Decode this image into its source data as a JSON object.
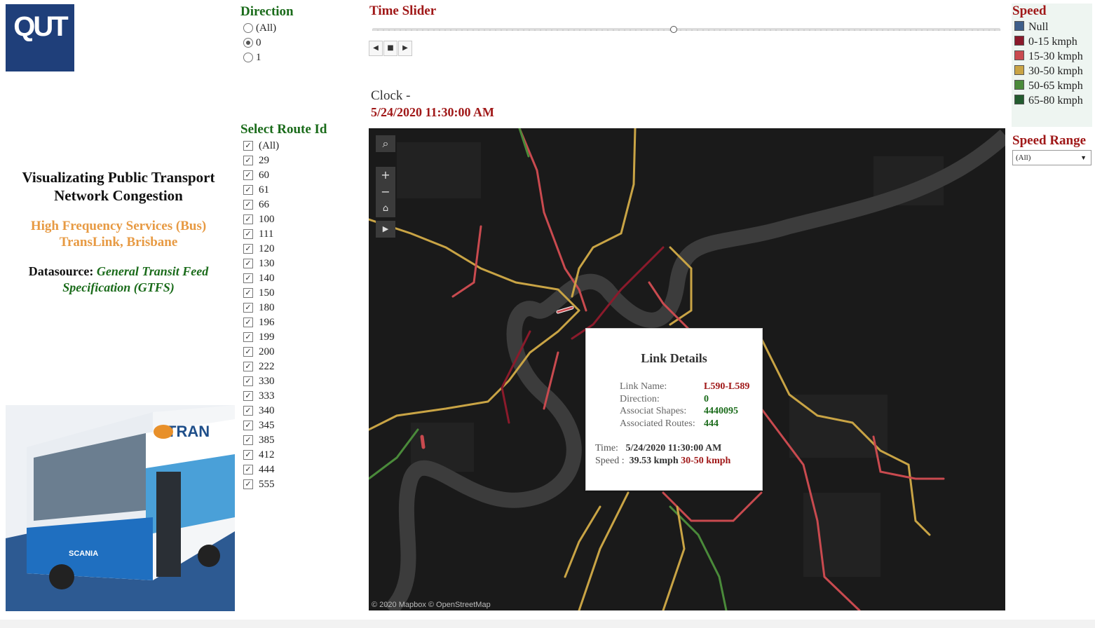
{
  "logo": {
    "text": "QUT"
  },
  "left_panel": {
    "title": "Visualizating Public Transport Network Congestion",
    "subtitle_line1": "High Frequency Services (Bus)",
    "subtitle_line2": "TransLink, Brisbane",
    "datasource_label": "Datasource:",
    "datasource_value": "General Transit Feed Specification (GTFS)"
  },
  "direction_filter": {
    "title": "Direction",
    "options": [
      "(All)",
      "0",
      "1"
    ],
    "selected": "0"
  },
  "route_filter": {
    "title": "Select Route Id",
    "options": [
      "(All)",
      "29",
      "60",
      "61",
      "66",
      "100",
      "111",
      "120",
      "130",
      "140",
      "150",
      "180",
      "196",
      "199",
      "200",
      "222",
      "330",
      "333",
      "340",
      "345",
      "385",
      "412",
      "444",
      "555"
    ],
    "all_checked": true
  },
  "time_slider": {
    "title": "Time Slider",
    "position_fraction": 0.48,
    "prev_icon": "step-back-icon",
    "stop_icon": "stop-icon",
    "next_icon": "step-forward-icon"
  },
  "clock": {
    "label": "Clock -",
    "value": "5/24/2020 11:30:00 AM"
  },
  "legend": {
    "title": "Speed",
    "items": [
      {
        "label": "Null",
        "color": "#3e5f8a"
      },
      {
        "label": "0-15 kmph",
        "color": "#8b1a2b"
      },
      {
        "label": "15-30 kmph",
        "color": "#c94a4f"
      },
      {
        "label": "30-50 kmph",
        "color": "#c9a445"
      },
      {
        "label": "50-65 kmph",
        "color": "#4a8a3a"
      },
      {
        "label": "65-80 kmph",
        "color": "#235c2f"
      }
    ]
  },
  "speed_range": {
    "title": "Speed Range",
    "selected": "(All)"
  },
  "map": {
    "attribution": "© 2020 Mapbox  © OpenStreetMap",
    "search_icon": "search-icon",
    "zoom_in": "+",
    "zoom_out": "−",
    "home_icon": "home-icon",
    "expand_icon": "expand-arrow-icon"
  },
  "tooltip": {
    "title": "Link Details",
    "link_name_label": "Link Name:",
    "link_name": "L590-L589",
    "direction_label": "Direction:",
    "direction": "0",
    "shapes_label": "Associat Shapes:",
    "shapes": "4440095",
    "routes_label": "Associated Routes:",
    "routes": "444",
    "time_label": "Time:",
    "time": "5/24/2020 11:30:00 AM",
    "speed_label": "Speed :",
    "speed": "39.53 kmph",
    "speed_class": "30-50 kmph"
  }
}
